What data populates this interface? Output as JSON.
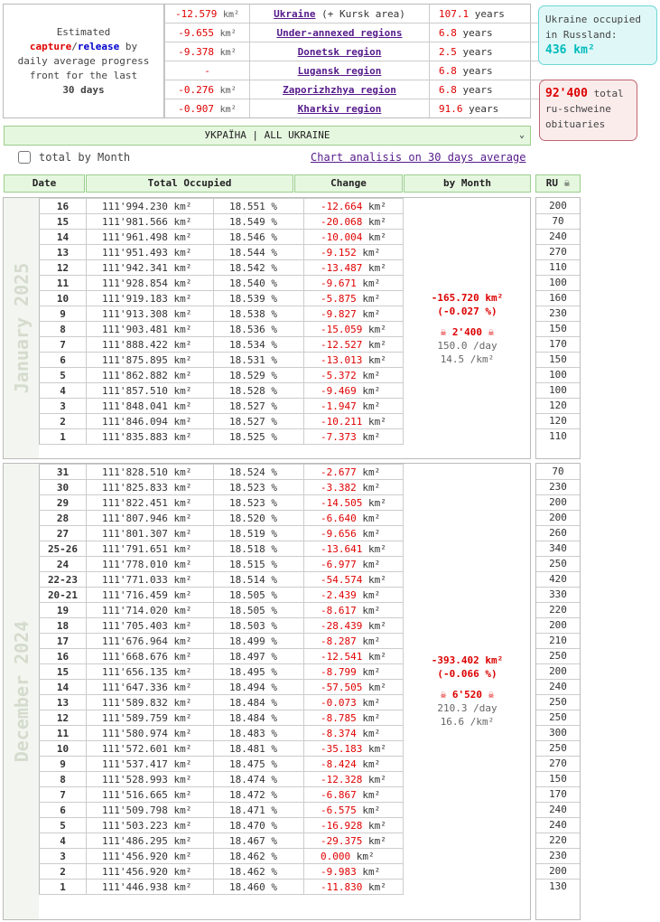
{
  "estimate": {
    "line1": "Estimated",
    "capture": "capture",
    "slash": "/",
    "release": "release",
    "by": " by",
    "line3": "daily average progress",
    "line4": "front for the last",
    "days": "30 days"
  },
  "regions": [
    {
      "change": "-12.579",
      "unit": "km²",
      "name": "Ukraine",
      "suffix": " (+ Kursk area)",
      "years": "107.1",
      "years_unit": "years"
    },
    {
      "change": "-9.655",
      "unit": "km²",
      "name": "Under-annexed regions",
      "suffix": "",
      "years": "6.8",
      "years_unit": "years"
    },
    {
      "change": "-9.378",
      "unit": "km²",
      "name": "Donetsk region",
      "suffix": "",
      "years": "2.5",
      "years_unit": "years"
    },
    {
      "change": "-",
      "unit": "",
      "name": "Lugansk region",
      "suffix": "",
      "years": "6.8",
      "years_unit": "years"
    },
    {
      "change": "-0.276",
      "unit": "km²",
      "name": "Zaporizhzhya region",
      "suffix": "",
      "years": "6.8",
      "years_unit": "years"
    },
    {
      "change": "-0.907",
      "unit": "km²",
      "name": "Kharkiv region",
      "suffix": "",
      "years": "91.6",
      "years_unit": "years"
    }
  ],
  "occupied": {
    "line1": "Ukraine occupied",
    "line2": "in Russland:",
    "area": "436 km²"
  },
  "obituaries": {
    "number": "92'400",
    "line1": " total",
    "line2": "ru-schweine",
    "line3": "obituaries"
  },
  "selector": {
    "value": "УКРАЇНА | ALL UKRAINE",
    "arrow": "⌄"
  },
  "checkbox": {
    "label": "total by Month",
    "checked": false
  },
  "chart_link": "Chart analisis on 30 days average",
  "headers": {
    "date": "Date",
    "total": "Total Occupied",
    "change": "Change",
    "by_month": "by Month",
    "ru": "RU ☠"
  },
  "units": {
    "km2": "km²",
    "pct": "%"
  },
  "january": {
    "name": "January 2025",
    "summary": {
      "change": "-165.720",
      "unit": "km²",
      "pct": "(-0.027 %)",
      "skull": "☠ 2'400 ☠",
      "per_day": "150.0 /day",
      "per_km": "14.5 /km²"
    },
    "rows": [
      {
        "day": "16",
        "total": "111'994.230",
        "pct": "18.551",
        "change": "-12.664",
        "ru": "200"
      },
      {
        "day": "15",
        "total": "111'981.566",
        "pct": "18.549",
        "change": "-20.068",
        "ru": "70"
      },
      {
        "day": "14",
        "total": "111'961.498",
        "pct": "18.546",
        "change": "-10.004",
        "ru": "240"
      },
      {
        "day": "13",
        "total": "111'951.493",
        "pct": "18.544",
        "change": "-9.152",
        "ru": "270"
      },
      {
        "day": "12",
        "total": "111'942.341",
        "pct": "18.542",
        "change": "-13.487",
        "ru": "110"
      },
      {
        "day": "11",
        "total": "111'928.854",
        "pct": "18.540",
        "change": "-9.671",
        "ru": "100"
      },
      {
        "day": "10",
        "total": "111'919.183",
        "pct": "18.539",
        "change": "-5.875",
        "ru": "160"
      },
      {
        "day": "9",
        "total": "111'913.308",
        "pct": "18.538",
        "change": "-9.827",
        "ru": "230"
      },
      {
        "day": "8",
        "total": "111'903.481",
        "pct": "18.536",
        "change": "-15.059",
        "ru": "150"
      },
      {
        "day": "7",
        "total": "111'888.422",
        "pct": "18.534",
        "change": "-12.527",
        "ru": "170"
      },
      {
        "day": "6",
        "total": "111'875.895",
        "pct": "18.531",
        "change": "-13.013",
        "ru": "150"
      },
      {
        "day": "5",
        "total": "111'862.882",
        "pct": "18.529",
        "change": "-5.372",
        "ru": "100"
      },
      {
        "day": "4",
        "total": "111'857.510",
        "pct": "18.528",
        "change": "-9.469",
        "ru": "100"
      },
      {
        "day": "3",
        "total": "111'848.041",
        "pct": "18.527",
        "change": "-1.947",
        "ru": "120"
      },
      {
        "day": "2",
        "total": "111'846.094",
        "pct": "18.527",
        "change": "-10.211",
        "ru": "120"
      },
      {
        "day": "1",
        "total": "111'835.883",
        "pct": "18.525",
        "change": "-7.373",
        "ru": "110"
      }
    ]
  },
  "december": {
    "name": "December 2024",
    "summary": {
      "change": "-393.402",
      "unit": "km²",
      "pct": "(-0.066 %)",
      "skull": "☠ 6'520 ☠",
      "per_day": "210.3 /day",
      "per_km": "16.6 /km²"
    },
    "rows": [
      {
        "day": "31",
        "total": "111'828.510",
        "pct": "18.524",
        "change": "-2.677",
        "ru": "70"
      },
      {
        "day": "30",
        "total": "111'825.833",
        "pct": "18.523",
        "change": "-3.382",
        "ru": "230"
      },
      {
        "day": "29",
        "total": "111'822.451",
        "pct": "18.523",
        "change": "-14.505",
        "ru": "200"
      },
      {
        "day": "28",
        "total": "111'807.946",
        "pct": "18.520",
        "change": "-6.640",
        "ru": "200"
      },
      {
        "day": "27",
        "total": "111'801.307",
        "pct": "18.519",
        "change": "-9.656",
        "ru": "260"
      },
      {
        "day": "25-26",
        "total": "111'791.651",
        "pct": "18.518",
        "change": "-13.641",
        "ru": "340"
      },
      {
        "day": "24",
        "total": "111'778.010",
        "pct": "18.515",
        "change": "-6.977",
        "ru": "250"
      },
      {
        "day": "22-23",
        "total": "111'771.033",
        "pct": "18.514",
        "change": "-54.574",
        "ru": "420"
      },
      {
        "day": "20-21",
        "total": "111'716.459",
        "pct": "18.505",
        "change": "-2.439",
        "ru": "330"
      },
      {
        "day": "19",
        "total": "111'714.020",
        "pct": "18.505",
        "change": "-8.617",
        "ru": "220"
      },
      {
        "day": "18",
        "total": "111'705.403",
        "pct": "18.503",
        "change": "-28.439",
        "ru": "200"
      },
      {
        "day": "17",
        "total": "111'676.964",
        "pct": "18.499",
        "change": "-8.287",
        "ru": "210"
      },
      {
        "day": "16",
        "total": "111'668.676",
        "pct": "18.497",
        "change": "-12.541",
        "ru": "250"
      },
      {
        "day": "15",
        "total": "111'656.135",
        "pct": "18.495",
        "change": "-8.799",
        "ru": "200"
      },
      {
        "day": "14",
        "total": "111'647.336",
        "pct": "18.494",
        "change": "-57.505",
        "ru": "240"
      },
      {
        "day": "13",
        "total": "111'589.832",
        "pct": "18.484",
        "change": "-0.073",
        "ru": "250"
      },
      {
        "day": "12",
        "total": "111'589.759",
        "pct": "18.484",
        "change": "-8.785",
        "ru": "250"
      },
      {
        "day": "11",
        "total": "111'580.974",
        "pct": "18.483",
        "change": "-8.374",
        "ru": "300"
      },
      {
        "day": "10",
        "total": "111'572.601",
        "pct": "18.481",
        "change": "-35.183",
        "ru": "250"
      },
      {
        "day": "9",
        "total": "111'537.417",
        "pct": "18.475",
        "change": "-8.424",
        "ru": "270"
      },
      {
        "day": "8",
        "total": "111'528.993",
        "pct": "18.474",
        "change": "-12.328",
        "ru": "150"
      },
      {
        "day": "7",
        "total": "111'516.665",
        "pct": "18.472",
        "change": "-6.867",
        "ru": "170"
      },
      {
        "day": "6",
        "total": "111'509.798",
        "pct": "18.471",
        "change": "-6.575",
        "ru": "240"
      },
      {
        "day": "5",
        "total": "111'503.223",
        "pct": "18.470",
        "change": "-16.928",
        "ru": "240"
      },
      {
        "day": "4",
        "total": "111'486.295",
        "pct": "18.467",
        "change": "-29.375",
        "ru": "220"
      },
      {
        "day": "3",
        "total": "111'456.920",
        "pct": "18.462",
        "change": "0.000",
        "ru": "230"
      },
      {
        "day": "2",
        "total": "111'456.920",
        "pct": "18.462",
        "change": "-9.983",
        "ru": "200"
      },
      {
        "day": "1",
        "total": "111'446.938",
        "pct": "18.460",
        "change": "-11.830",
        "ru": "130"
      }
    ]
  }
}
